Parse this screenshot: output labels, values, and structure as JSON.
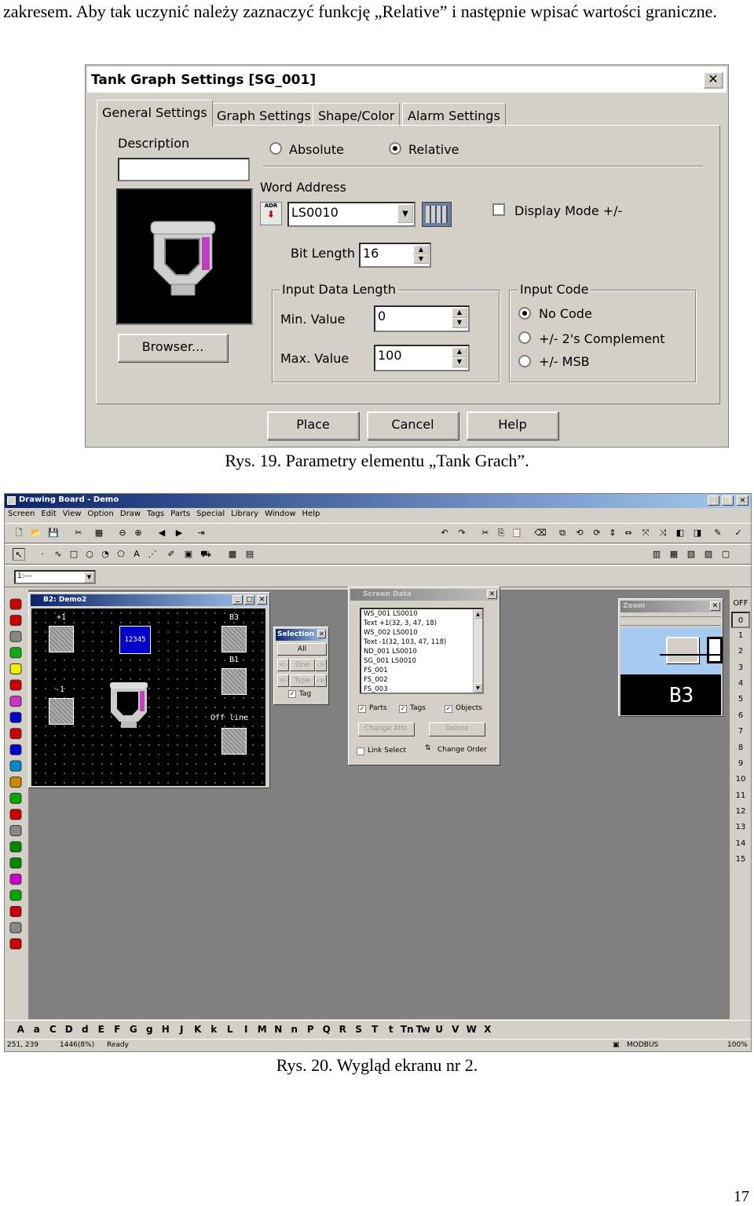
{
  "intro_text": "zakresem. Aby tak uczynić należy zaznaczyć funkcję „Relative” i następnie wpisać wartości graniczne.",
  "figure1": {
    "caption": "Rys. 19. Parametry elementu „Tank Grach”.",
    "dialog_title": "Tank Graph Settings [SG_001]",
    "close_glyph": "✕",
    "tabs": [
      "General Settings",
      "Graph Settings",
      "Shape/Color",
      "Alarm Settings"
    ],
    "active_tab": "General Settings",
    "description_label": "Description",
    "description_value": "",
    "mode_absolute": "Absolute",
    "mode_relative": "Relative",
    "mode_selected": "Relative",
    "word_address_label": "Word Address",
    "adr_label": "ADR",
    "word_address_value": "LS0010",
    "display_mode_label": "Display Mode +/-",
    "display_mode_checked": false,
    "bit_length_label": "Bit Length",
    "bit_length_value": "16",
    "input_data_length_label": "Input Data Length",
    "min_value_label": "Min. Value",
    "min_value": "0",
    "max_value_label": "Max. Value",
    "max_value": "100",
    "input_code_label": "Input Code",
    "input_code_options": [
      "No Code",
      "+/- 2's Complement",
      "+/- MSB"
    ],
    "input_code_selected": "No Code",
    "browser_button": "Browser...",
    "buttons": {
      "place": "Place",
      "cancel": "Cancel",
      "help": "Help"
    }
  },
  "figure2": {
    "caption": "Rys. 20. Wygląd ekranu nr 2.",
    "app_title": "Drawing Board - Demo",
    "menu": [
      "Screen",
      "Edit",
      "View",
      "Option",
      "Draw",
      "Tags",
      "Parts",
      "Special",
      "Library",
      "Window",
      "Help"
    ],
    "layer_select": "1:---",
    "screen_window": {
      "title": "B2: Demo2",
      "labels": {
        "plus1": "+1",
        "minus1": "-1",
        "b3": "B3",
        "b1": "B1",
        "offline": "Off line",
        "numeric": "12345"
      }
    },
    "selection_window": {
      "title": "Selection",
      "all": "All",
      "one": "One",
      "type": "Type",
      "tag": "Tag",
      "prev": "<-",
      "next": "->",
      "tag_checked": true
    },
    "screen_data_window": {
      "title": "Screen Data",
      "items": [
        "WS_001  LS0010",
        "Text +1(32, 3, 47, 18)",
        "WS_002  LS0010",
        "Text -1(32, 103, 47, 118)",
        "ND_001  LS0010",
        "SG_001  LS0010",
        "FS_001",
        "FS_002",
        "FS_003"
      ],
      "parts": "Parts",
      "tags": "Tags",
      "objects": "Objects",
      "change_attr": "Change Attr.",
      "delete": "Delete",
      "link_select": "Link Select",
      "change_order": "Change Order"
    },
    "zoom_window": {
      "title": "Zoom",
      "label": "B3"
    },
    "layer_numbers": [
      "OFF",
      "0",
      "1",
      "2",
      "3",
      "4",
      "5",
      "6",
      "7",
      "8",
      "9",
      "10",
      "11",
      "12",
      "13",
      "14",
      "15"
    ],
    "alphabet": [
      "A",
      "a",
      "C",
      "D",
      "d",
      "E",
      "F",
      "G",
      "g",
      "H",
      "J",
      "K",
      "k",
      "L",
      "I",
      "M",
      "N",
      "n",
      "P",
      "Q",
      "R",
      "S",
      "T",
      "t",
      "Tn",
      "Tw",
      "U",
      "V",
      "W",
      "X"
    ],
    "status": {
      "coords": "251, 239",
      "memory": "1446(8%)",
      "state": "Ready",
      "protocol": "MODBUS",
      "zoom": "100%"
    }
  },
  "page_number": "17"
}
